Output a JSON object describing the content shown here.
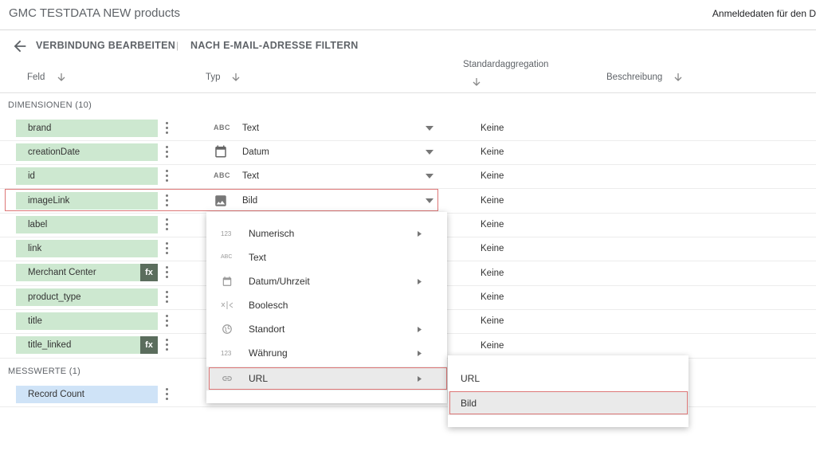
{
  "header": {
    "title": "GMC TESTDATA NEW products",
    "credentials": "Anmeldedaten für den D"
  },
  "toolbar": {
    "edit_connection": "VERBINDUNG BEARBEITEN",
    "separator": "|",
    "filter_email": "NACH E-MAIL-ADRESSE FILTERN"
  },
  "columns": {
    "field": "Feld",
    "type": "Typ",
    "aggregation": "Standardaggregation",
    "description": "Beschreibung"
  },
  "dimensions": {
    "label": "DIMENSIONEN (10)",
    "rows": [
      {
        "name": "brand",
        "type": "Text",
        "type_icon": "abc-icon",
        "aggregation": "Keine"
      },
      {
        "name": "creationDate",
        "type": "Datum",
        "type_icon": "calendar-icon",
        "aggregation": "Keine"
      },
      {
        "name": "id",
        "type": "Text",
        "type_icon": "abc-icon",
        "aggregation": "Keine"
      },
      {
        "name": "imageLink",
        "type": "Bild",
        "type_icon": "image-icon",
        "aggregation": "Keine"
      },
      {
        "name": "label",
        "aggregation": "Keine"
      },
      {
        "name": "link",
        "aggregation": "Keine"
      },
      {
        "name": "Merchant Center",
        "fx": "fx",
        "aggregation": "Keine"
      },
      {
        "name": "product_type",
        "aggregation": "Keine"
      },
      {
        "name": "title",
        "aggregation": "Keine"
      },
      {
        "name": "title_linked",
        "fx": "fx",
        "aggregation": "Keine"
      }
    ]
  },
  "metrics": {
    "label": "MESSWERTE (1)",
    "rows": [
      {
        "name": "Record Count"
      }
    ]
  },
  "type_menu": {
    "items": [
      {
        "label": "Numerisch",
        "icon": "123",
        "has_submenu": true
      },
      {
        "label": "Text",
        "icon": "ABC",
        "has_submenu": false
      },
      {
        "label": "Datum/Uhrzeit",
        "icon": "calendar-icon",
        "has_submenu": true
      },
      {
        "label": "Boolesch",
        "icon": "boolean-icon",
        "has_submenu": false
      },
      {
        "label": "Standort",
        "icon": "globe-icon",
        "has_submenu": true
      },
      {
        "label": "Währung",
        "icon": "123",
        "has_submenu": true
      },
      {
        "label": "URL",
        "icon": "link-icon",
        "has_submenu": true,
        "selected": true
      }
    ]
  },
  "url_submenu": {
    "items": [
      {
        "label": "URL"
      },
      {
        "label": "Bild",
        "selected": true
      }
    ]
  },
  "colors": {
    "dimension_chip": "#cde8d0",
    "metric_chip": "#cfe3f7",
    "fx_badge": "#5b6d5d",
    "highlight": "#d77777"
  }
}
